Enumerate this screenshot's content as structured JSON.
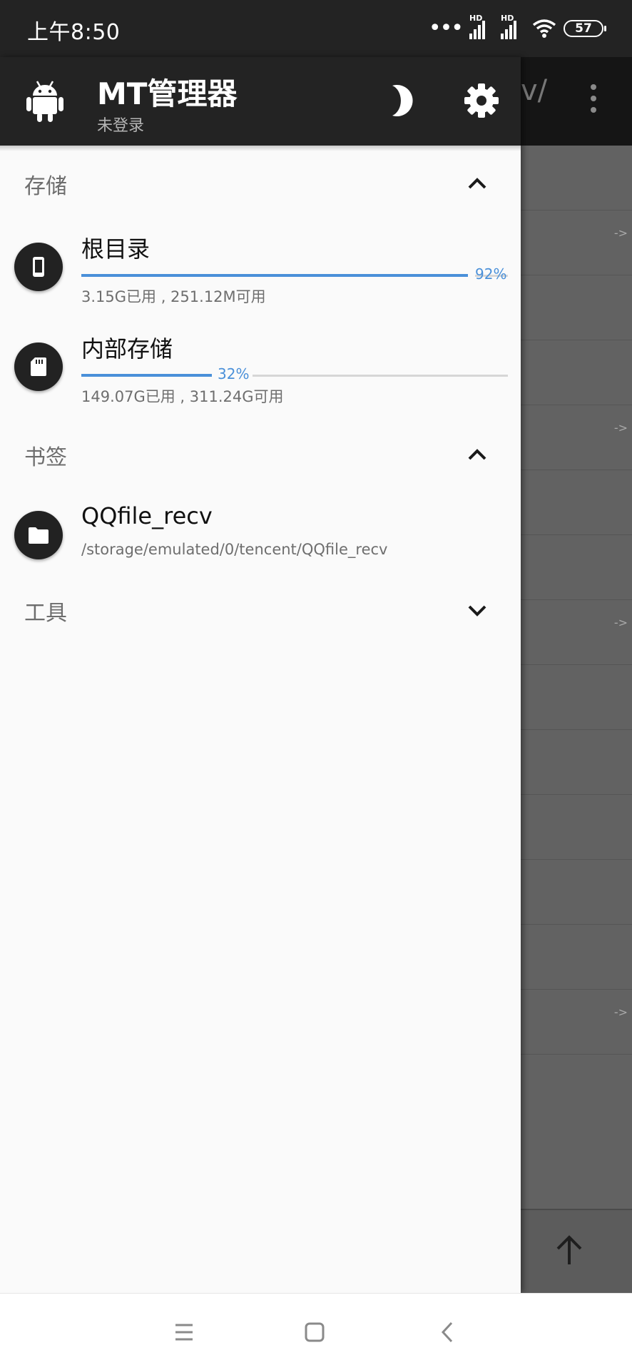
{
  "status_bar": {
    "time": "上午8:50",
    "signal_dots": "•••",
    "hd_label": "HD",
    "battery": "57"
  },
  "drawer": {
    "app_title": "MT管理器",
    "login_status": "未登录",
    "sections": {
      "storage": {
        "title": "存储",
        "items": [
          {
            "title": "根目录",
            "percent_label": "92%",
            "percent": 92,
            "detail": "3.15G已用 , 251.12M可用",
            "icon": "phone-icon"
          },
          {
            "title": "内部存储",
            "percent_label": "32%",
            "percent": 32,
            "detail": "149.07G已用 , 311.24G可用",
            "icon": "sd-card-icon"
          }
        ]
      },
      "bookmarks": {
        "title": "书签",
        "items": [
          {
            "title": "QQfile_recv",
            "path": "/storage/emulated/0/tencent/QQfile_recv",
            "icon": "folder-icon"
          }
        ]
      },
      "tools": {
        "title": "工具"
      }
    }
  },
  "background": {
    "path_fragment": "v/",
    "link_arrow": "->"
  },
  "colors": {
    "accent": "#4a90d9",
    "header": "#232323",
    "drawer_bg": "#fafafa"
  }
}
